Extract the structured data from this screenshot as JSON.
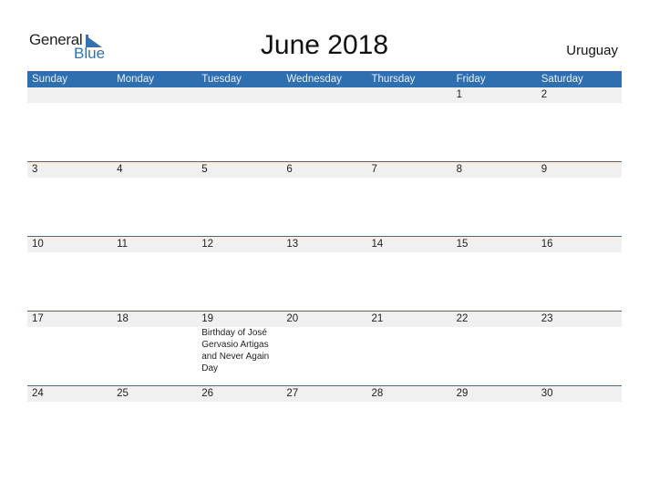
{
  "logo": {
    "word1": "General",
    "word2": "Blue"
  },
  "title": "June 2018",
  "country": "Uruguay",
  "colors": {
    "accent": "#2e6fb0",
    "date_row_bg": "#f0f0f0"
  },
  "weekdays": [
    "Sunday",
    "Monday",
    "Tuesday",
    "Wednesday",
    "Thursday",
    "Friday",
    "Saturday"
  ],
  "weeks": [
    {
      "days": [
        "",
        "",
        "",
        "",
        "",
        "1",
        "2"
      ],
      "events": [
        "",
        "",
        "",
        "",
        "",
        "",
        ""
      ]
    },
    {
      "days": [
        "3",
        "4",
        "5",
        "6",
        "7",
        "8",
        "9"
      ],
      "events": [
        "",
        "",
        "",
        "",
        "",
        "",
        ""
      ]
    },
    {
      "days": [
        "10",
        "11",
        "12",
        "13",
        "14",
        "15",
        "16"
      ],
      "events": [
        "",
        "",
        "",
        "",
        "",
        "",
        ""
      ]
    },
    {
      "days": [
        "17",
        "18",
        "19",
        "20",
        "21",
        "22",
        "23"
      ],
      "events": [
        "",
        "",
        "Birthday of José Gervasio Artigas and Never Again Day",
        "",
        "",
        "",
        ""
      ]
    },
    {
      "days": [
        "24",
        "25",
        "26",
        "27",
        "28",
        "29",
        "30"
      ],
      "events": [
        "",
        "",
        "",
        "",
        "",
        "",
        ""
      ]
    }
  ]
}
